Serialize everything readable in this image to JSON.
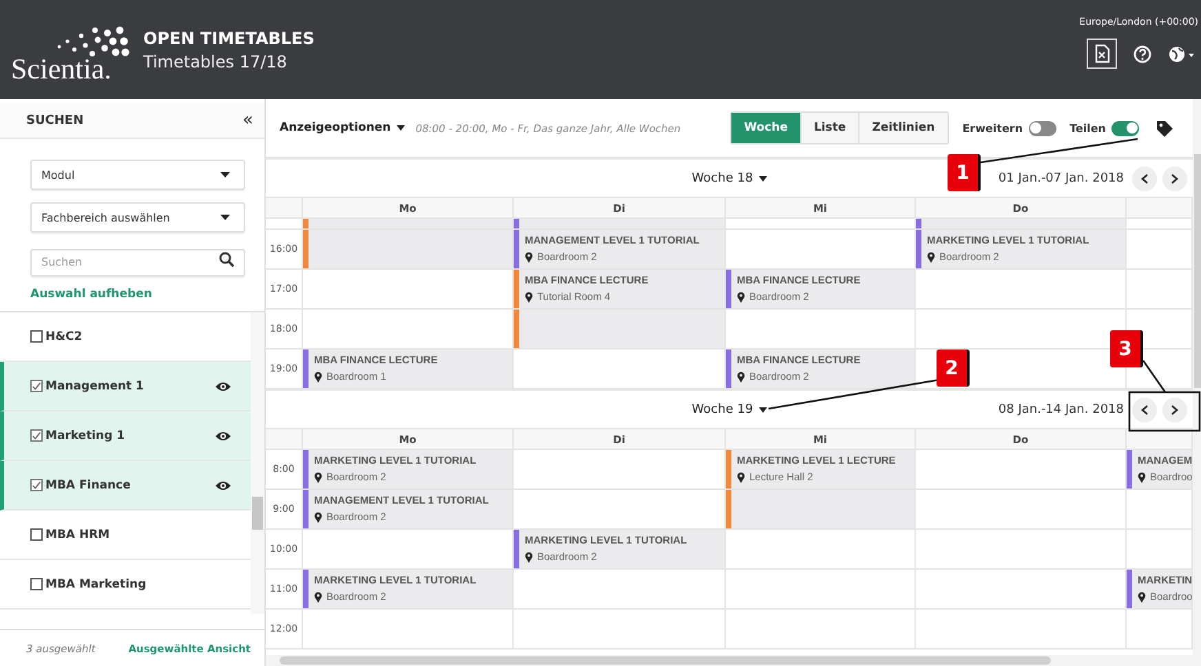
{
  "header": {
    "brand": "Scientia.",
    "app_title": "OPEN TIMETABLES",
    "subtitle": "Timetables 17/18",
    "timezone": "Europe/London (+00:00)"
  },
  "sidebar": {
    "title": "SUCHEN",
    "collapse": "«",
    "dropdowns": [
      "Modul",
      "Fachbereich auswählen"
    ],
    "search": {
      "placeholder": "Suchen"
    },
    "clear_link": "Auswahl aufheben",
    "items": [
      {
        "label": "H&C2",
        "checked": false
      },
      {
        "label": "Management 1",
        "checked": true
      },
      {
        "label": "Marketing 1",
        "checked": true
      },
      {
        "label": "MBA Finance",
        "checked": true
      },
      {
        "label": "MBA HRM",
        "checked": false
      },
      {
        "label": "MBA Marketing",
        "checked": false
      }
    ],
    "footer": {
      "count": "3 ausgewählt",
      "action": "Ausgewählte Ansicht"
    }
  },
  "toolbar": {
    "options": "Anzeigeoptionen",
    "summary": "08:00 - 20:00, Mo - Fr, Das ganze Jahr, Alle Wochen",
    "tabs": [
      {
        "label": "Woche",
        "selected": true
      },
      {
        "label": "Liste",
        "selected": false
      },
      {
        "label": "Zeitlinien",
        "selected": false
      }
    ],
    "toggles": [
      {
        "label": "Erweitern",
        "on": false
      },
      {
        "label": "Teilen",
        "on": true
      }
    ]
  },
  "weeks": [
    {
      "title": "Woche 18",
      "dates": "01 Jan.-07 Jan. 2018",
      "days": [
        "Mo",
        "Di",
        "Mi",
        "Do"
      ],
      "rows": [
        {
          "slots": [
            {
              "kind": "continued",
              "color": "#f0883e"
            },
            {
              "kind": "continued",
              "color": "#8a6de0"
            },
            {
              "kind": "empty"
            },
            {
              "kind": "continued",
              "color": "#8a6de0"
            },
            {
              "kind": "empty"
            }
          ]
        },
        {
          "time": "16:00",
          "slots": [
            {
              "kind": "continued",
              "color": "#f0883e"
            },
            {
              "kind": "event",
              "title": "MANAGEMENT LEVEL 1 TUTORIAL",
              "room": "Boardroom 2",
              "color": "#8a6de0"
            },
            {
              "kind": "empty"
            },
            {
              "kind": "event",
              "title": "MARKETING LEVEL 1 TUTORIAL",
              "room": "Boardroom 2",
              "color": "#8a6de0"
            },
            {
              "kind": "empty"
            }
          ]
        },
        {
          "time": "17:00",
          "slots": [
            {
              "kind": "empty"
            },
            {
              "kind": "event",
              "title": "MBA FINANCE LECTURE",
              "room": "Tutorial Room 4",
              "color": "#f0883e"
            },
            {
              "kind": "event",
              "title": "MBA FINANCE LECTURE",
              "room": "Boardroom 2",
              "color": "#8a6de0"
            },
            {
              "kind": "empty"
            },
            {
              "kind": "empty"
            }
          ]
        },
        {
          "time": "18:00",
          "slots": [
            {
              "kind": "empty"
            },
            {
              "kind": "continued",
              "color": "#f0883e"
            },
            {
              "kind": "empty"
            },
            {
              "kind": "empty"
            },
            {
              "kind": "empty"
            }
          ]
        },
        {
          "time": "19:00",
          "slots": [
            {
              "kind": "event",
              "title": "MBA FINANCE LECTURE",
              "room": "Boardroom 1",
              "color": "#8a6de0"
            },
            {
              "kind": "empty"
            },
            {
              "kind": "event",
              "title": "MBA FINANCE LECTURE",
              "room": "Boardroom 2",
              "color": "#8a6de0"
            },
            {
              "kind": "empty"
            },
            {
              "kind": "empty"
            }
          ]
        }
      ]
    },
    {
      "title": "Woche 19",
      "dates": "08 Jan.-14 Jan. 2018",
      "days": [
        "Mo",
        "Di",
        "Mi",
        "Do"
      ],
      "rows": [
        {
          "time": "8:00",
          "slots": [
            {
              "kind": "event",
              "title": "MARKETING LEVEL 1 TUTORIAL",
              "room": "Boardroom 2",
              "color": "#8a6de0"
            },
            {
              "kind": "empty"
            },
            {
              "kind": "event",
              "title": "MARKETING LEVEL 1 LECTURE",
              "room": "Lecture Hall 2",
              "color": "#f0883e"
            },
            {
              "kind": "empty"
            },
            {
              "kind": "event",
              "title": "MANAGEM",
              "room": "Boardroo",
              "color": "#8a6de0"
            }
          ]
        },
        {
          "time": "9:00",
          "slots": [
            {
              "kind": "event",
              "title": "MANAGEMENT LEVEL 1 TUTORIAL",
              "room": "Boardroom 2",
              "color": "#8a6de0"
            },
            {
              "kind": "empty"
            },
            {
              "kind": "continued",
              "color": "#f0883e"
            },
            {
              "kind": "empty"
            },
            {
              "kind": "empty"
            }
          ]
        },
        {
          "time": "10:00",
          "slots": [
            {
              "kind": "empty"
            },
            {
              "kind": "event",
              "title": "MARKETING LEVEL 1 TUTORIAL",
              "room": "Boardroom 2",
              "color": "#8a6de0"
            },
            {
              "kind": "empty"
            },
            {
              "kind": "empty"
            },
            {
              "kind": "empty"
            }
          ]
        },
        {
          "time": "11:00",
          "slots": [
            {
              "kind": "event",
              "title": "MARKETING LEVEL 1 TUTORIAL",
              "room": "Boardroom 2",
              "color": "#8a6de0"
            },
            {
              "kind": "empty"
            },
            {
              "kind": "empty"
            },
            {
              "kind": "empty"
            },
            {
              "kind": "event",
              "title": "MARKETIN",
              "room": "Boardroo",
              "color": "#8a6de0"
            }
          ]
        },
        {
          "time": "12:00",
          "slots": [
            {
              "kind": "empty"
            },
            {
              "kind": "empty"
            },
            {
              "kind": "empty"
            },
            {
              "kind": "empty"
            },
            {
              "kind": "empty"
            }
          ]
        }
      ]
    }
  ],
  "annotations": [
    {
      "label": "1"
    },
    {
      "label": "2"
    },
    {
      "label": "3"
    }
  ]
}
